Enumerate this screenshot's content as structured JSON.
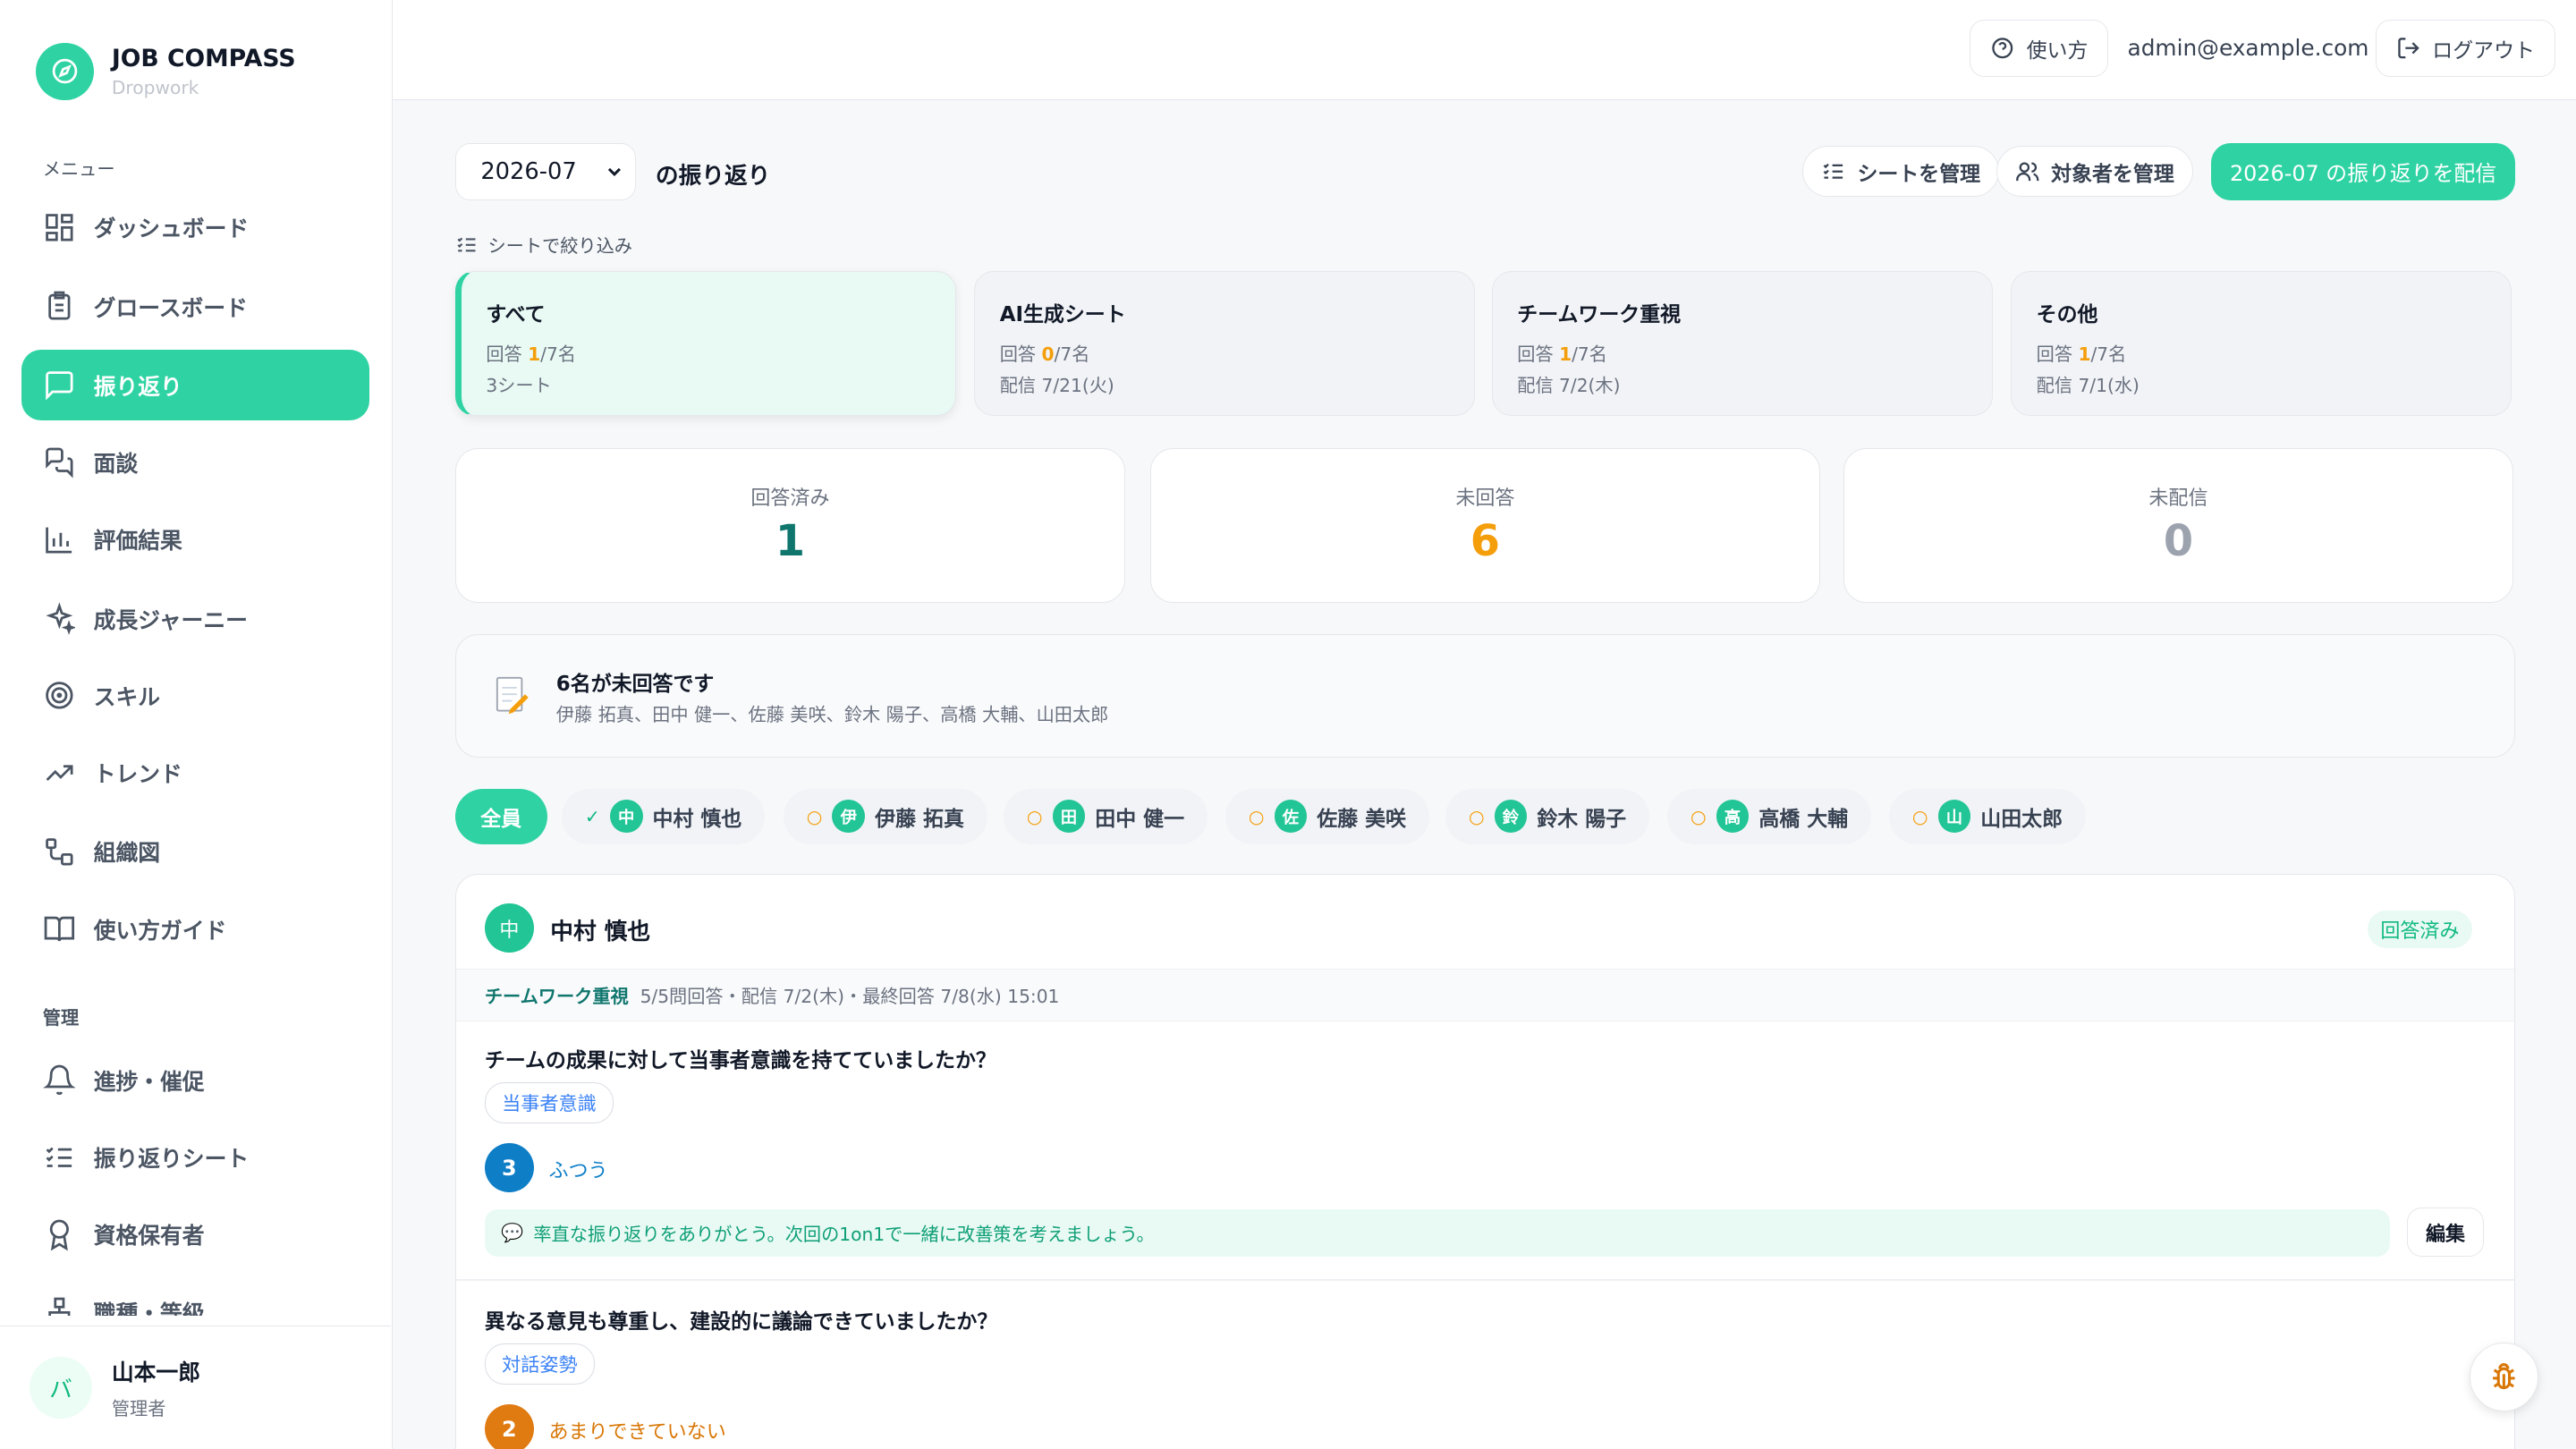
{
  "app": {
    "name": "JOB COMPASS",
    "sub": "Dropwork"
  },
  "sidebar": {
    "menu_label": "メニュー",
    "items": [
      "ダッシュボード",
      "グロースボード",
      "振り返り",
      "面談",
      "評価結果",
      "成長ジャーニー",
      "スキル",
      "トレンド",
      "組織図",
      "使い方ガイド"
    ],
    "admin_label": "管理",
    "admin_items": [
      "進捗・催促",
      "振り返りシート",
      "資格保有者",
      "職種・等級"
    ]
  },
  "user": {
    "avatar": "バ",
    "name": "山本一郎",
    "role": "管理者"
  },
  "topbar": {
    "help": "使い方",
    "email": "admin@example.com",
    "logout": "ログアウト"
  },
  "header": {
    "month": "2026-07",
    "suffix": "の振り返り",
    "manage_sheets": "シートを管理",
    "manage_targets": "対象者を管理",
    "distribute": "2026-07 の振り返りを配信",
    "filter_label": "シートで絞り込み"
  },
  "sheets": [
    {
      "title": "すべて",
      "answered": "1",
      "total": "/7名",
      "resp": "回答 ",
      "info": "3シート"
    },
    {
      "title": "AI生成シート",
      "answered": "0",
      "total": "/7名",
      "resp": "回答 ",
      "info": "配信 7/21(火)"
    },
    {
      "title": "チームワーク重視",
      "answered": "1",
      "total": "/7名",
      "resp": "回答 ",
      "info": "配信 7/2(木)"
    },
    {
      "title": "その他",
      "answered": "1",
      "total": "/7名",
      "resp": "回答 ",
      "info": "配信 7/1(水)"
    }
  ],
  "stats": [
    {
      "label": "回答済み",
      "value": "1",
      "color": "#0f766e"
    },
    {
      "label": "未回答",
      "value": "6",
      "color": "#f59e0b"
    },
    {
      "label": "未配信",
      "value": "0",
      "color": "#9ca3af"
    }
  ],
  "alert": {
    "title": "6名が未回答です",
    "names": "伊藤 拓真、田中 健一、佐藤 美咲、鈴木 陽子、高橋 大輔、山田太郎"
  },
  "chips": {
    "all": "全員",
    "people": [
      {
        "initial": "中",
        "name": "中村 慎也",
        "status": "✓"
      },
      {
        "initial": "伊",
        "name": "伊藤 拓真",
        "status": "○"
      },
      {
        "initial": "田",
        "name": "田中 健一",
        "status": "○"
      },
      {
        "initial": "佐",
        "name": "佐藤 美咲",
        "status": "○"
      },
      {
        "initial": "鈴",
        "name": "鈴木 陽子",
        "status": "○"
      },
      {
        "initial": "高",
        "name": "高橋 大輔",
        "status": "○"
      },
      {
        "initial": "山",
        "name": "山田太郎",
        "status": "○"
      }
    ]
  },
  "detail": {
    "initial": "中",
    "name": "中村 慎也",
    "badge": "回答済み",
    "sheet": "チームワーク重視",
    "meta": "5/5問回答・配信 7/2(木)・最終回答 7/8(水) 15:01",
    "questions": [
      {
        "text": "チームの成果に対して当事者意識を持てていましたか？",
        "tag": "当事者意識",
        "score": "3",
        "label": "ふつう",
        "comment": "率直な振り返りをありがとう。次回の1on1で一緒に改善策を考えましょう。",
        "edit": "編集"
      },
      {
        "text": "異なる意見も尊重し、建設的に議論できていましたか？",
        "tag": "対話姿勢",
        "score": "2",
        "label": "あまりできていない"
      }
    ]
  },
  "colors": {
    "accent": "#2fd3a3",
    "orange": "#f59e0b",
    "blue": "#0e7fc7",
    "teal": "#0f766e"
  }
}
